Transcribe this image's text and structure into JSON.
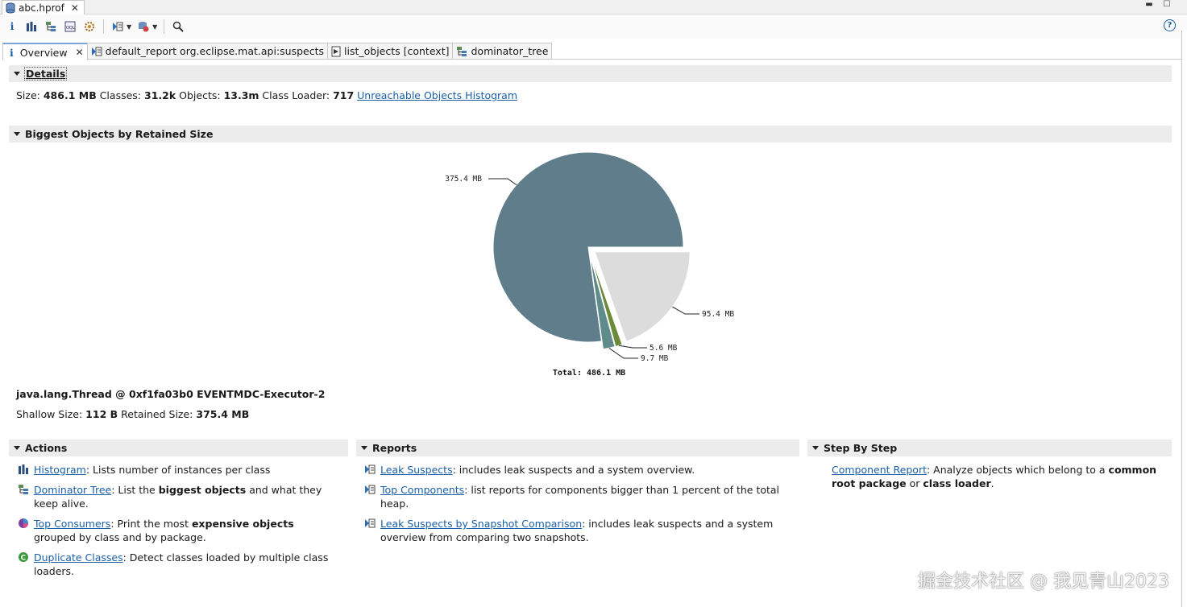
{
  "editor": {
    "file_tab": "abc.hprof"
  },
  "toolbar": {
    "buttons": [
      "info-icon",
      "histogram-icon",
      "dominator-tree-icon",
      "oql-icon",
      "heap-dump-overview-icon",
      "run-report-icon",
      "query-browser-icon",
      "search-icon"
    ]
  },
  "tabs": [
    {
      "label": "Overview",
      "icon": "info-icon"
    },
    {
      "label": "default_report org.eclipse.mat.api:suspects",
      "icon": "report-icon"
    },
    {
      "label": "list_objects [context]",
      "icon": "page-icon"
    },
    {
      "label": "dominator_tree",
      "icon": "dominator-tree-icon"
    }
  ],
  "details": {
    "title": "Details",
    "size_label": "Size:",
    "size": "486.1 MB",
    "classes_label": "Classes:",
    "classes": "31.2k",
    "objects_label": "Objects:",
    "objects": "13.3m",
    "loader_label": "Class Loader:",
    "loader": "717",
    "unreachable_link": "Unreachable Objects Histogram"
  },
  "biggest": {
    "title": "Biggest Objects by Retained Size",
    "selected_object": "java.lang.Thread @ 0xf1fa03b0 EVENTMDC-Executor-2",
    "shallow_label": "Shallow Size:",
    "shallow": "112 B",
    "retained_label": "Retained Size:",
    "retained": "375.4 MB"
  },
  "chart_data": {
    "type": "pie",
    "slices": [
      {
        "label": "375.4 MB",
        "value": 375.4,
        "color": "#607d8b",
        "exploded": false
      },
      {
        "label": "95.4 MB",
        "value": 95.4,
        "color": "#dcdcdc",
        "exploded": true
      },
      {
        "label": "5.6 MB",
        "value": 5.6,
        "color": "#6b8a3a",
        "exploded": true
      },
      {
        "label": "9.7 MB",
        "value": 9.7,
        "color": "#5f8c8a",
        "exploded": true
      }
    ],
    "total_label": "Total: 486.1 MB"
  },
  "actions": {
    "title": "Actions",
    "items": [
      {
        "link": "Histogram",
        "text_pre": ": Lists number of instances per class",
        "bold": "",
        "text_post": "",
        "icon": "histogram-icon"
      },
      {
        "link": "Dominator Tree",
        "text_pre": ": List the ",
        "bold": "biggest objects",
        "text_post": " and what they keep alive.",
        "icon": "dominator-tree-icon"
      },
      {
        "link": "Top Consumers",
        "text_pre": ": Print the most ",
        "bold": "expensive objects",
        "text_post": " grouped by class and by package.",
        "icon": "top-consumers-icon"
      },
      {
        "link": "Duplicate Classes",
        "text_pre": ": Detect classes loaded by multiple class loaders.",
        "bold": "",
        "text_post": "",
        "icon": "duplicate-classes-icon"
      }
    ]
  },
  "reports": {
    "title": "Reports",
    "items": [
      {
        "link": "Leak Suspects",
        "text": ": includes leak suspects and a system overview.",
        "icon": "report-icon"
      },
      {
        "link": "Top Components",
        "text": ": list reports for components bigger than 1 percent of the total heap.",
        "icon": "report-icon"
      },
      {
        "link": "Leak Suspects by Snapshot Comparison",
        "text": ": includes leak suspects and a system overview from comparing two snapshots.",
        "icon": "report-icon"
      }
    ]
  },
  "step": {
    "title": "Step By Step",
    "link": "Component Report",
    "text_pre": ": Analyze objects which belong to a ",
    "bold1": "common root package",
    "text_mid": " or ",
    "bold2": "class loader",
    "text_post": "."
  },
  "watermark": "掘金技术社区 @ 我见青山2023",
  "colors": {
    "link": "#1a5fa8",
    "pie_main": "#607d8b",
    "section_bg": "#ececec"
  }
}
